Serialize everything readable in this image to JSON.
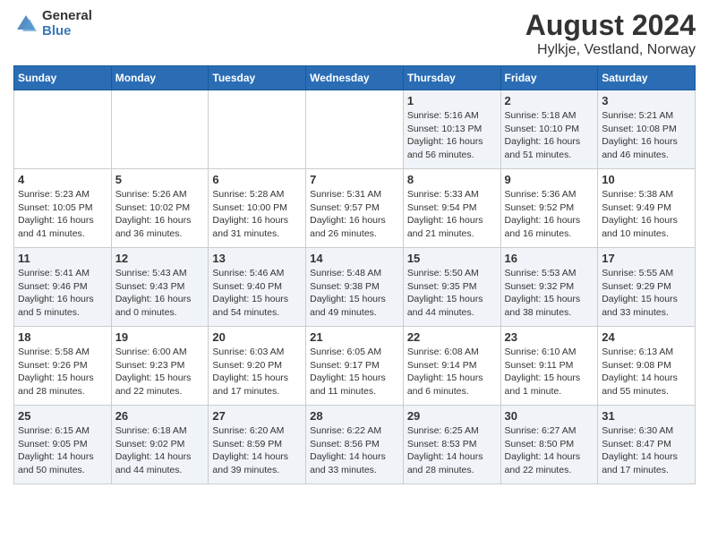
{
  "logo": {
    "line1": "General",
    "line2": "Blue"
  },
  "title": "August 2024",
  "subtitle": "Hylkje, Vestland, Norway",
  "headers": [
    "Sunday",
    "Monday",
    "Tuesday",
    "Wednesday",
    "Thursday",
    "Friday",
    "Saturday"
  ],
  "weeks": [
    [
      {
        "day": "",
        "info": ""
      },
      {
        "day": "",
        "info": ""
      },
      {
        "day": "",
        "info": ""
      },
      {
        "day": "",
        "info": ""
      },
      {
        "day": "1",
        "info": "Sunrise: 5:16 AM\nSunset: 10:13 PM\nDaylight: 16 hours\nand 56 minutes."
      },
      {
        "day": "2",
        "info": "Sunrise: 5:18 AM\nSunset: 10:10 PM\nDaylight: 16 hours\nand 51 minutes."
      },
      {
        "day": "3",
        "info": "Sunrise: 5:21 AM\nSunset: 10:08 PM\nDaylight: 16 hours\nand 46 minutes."
      }
    ],
    [
      {
        "day": "4",
        "info": "Sunrise: 5:23 AM\nSunset: 10:05 PM\nDaylight: 16 hours\nand 41 minutes."
      },
      {
        "day": "5",
        "info": "Sunrise: 5:26 AM\nSunset: 10:02 PM\nDaylight: 16 hours\nand 36 minutes."
      },
      {
        "day": "6",
        "info": "Sunrise: 5:28 AM\nSunset: 10:00 PM\nDaylight: 16 hours\nand 31 minutes."
      },
      {
        "day": "7",
        "info": "Sunrise: 5:31 AM\nSunset: 9:57 PM\nDaylight: 16 hours\nand 26 minutes."
      },
      {
        "day": "8",
        "info": "Sunrise: 5:33 AM\nSunset: 9:54 PM\nDaylight: 16 hours\nand 21 minutes."
      },
      {
        "day": "9",
        "info": "Sunrise: 5:36 AM\nSunset: 9:52 PM\nDaylight: 16 hours\nand 16 minutes."
      },
      {
        "day": "10",
        "info": "Sunrise: 5:38 AM\nSunset: 9:49 PM\nDaylight: 16 hours\nand 10 minutes."
      }
    ],
    [
      {
        "day": "11",
        "info": "Sunrise: 5:41 AM\nSunset: 9:46 PM\nDaylight: 16 hours\nand 5 minutes."
      },
      {
        "day": "12",
        "info": "Sunrise: 5:43 AM\nSunset: 9:43 PM\nDaylight: 16 hours\nand 0 minutes."
      },
      {
        "day": "13",
        "info": "Sunrise: 5:46 AM\nSunset: 9:40 PM\nDaylight: 15 hours\nand 54 minutes."
      },
      {
        "day": "14",
        "info": "Sunrise: 5:48 AM\nSunset: 9:38 PM\nDaylight: 15 hours\nand 49 minutes."
      },
      {
        "day": "15",
        "info": "Sunrise: 5:50 AM\nSunset: 9:35 PM\nDaylight: 15 hours\nand 44 minutes."
      },
      {
        "day": "16",
        "info": "Sunrise: 5:53 AM\nSunset: 9:32 PM\nDaylight: 15 hours\nand 38 minutes."
      },
      {
        "day": "17",
        "info": "Sunrise: 5:55 AM\nSunset: 9:29 PM\nDaylight: 15 hours\nand 33 minutes."
      }
    ],
    [
      {
        "day": "18",
        "info": "Sunrise: 5:58 AM\nSunset: 9:26 PM\nDaylight: 15 hours\nand 28 minutes."
      },
      {
        "day": "19",
        "info": "Sunrise: 6:00 AM\nSunset: 9:23 PM\nDaylight: 15 hours\nand 22 minutes."
      },
      {
        "day": "20",
        "info": "Sunrise: 6:03 AM\nSunset: 9:20 PM\nDaylight: 15 hours\nand 17 minutes."
      },
      {
        "day": "21",
        "info": "Sunrise: 6:05 AM\nSunset: 9:17 PM\nDaylight: 15 hours\nand 11 minutes."
      },
      {
        "day": "22",
        "info": "Sunrise: 6:08 AM\nSunset: 9:14 PM\nDaylight: 15 hours\nand 6 minutes."
      },
      {
        "day": "23",
        "info": "Sunrise: 6:10 AM\nSunset: 9:11 PM\nDaylight: 15 hours\nand 1 minute."
      },
      {
        "day": "24",
        "info": "Sunrise: 6:13 AM\nSunset: 9:08 PM\nDaylight: 14 hours\nand 55 minutes."
      }
    ],
    [
      {
        "day": "25",
        "info": "Sunrise: 6:15 AM\nSunset: 9:05 PM\nDaylight: 14 hours\nand 50 minutes."
      },
      {
        "day": "26",
        "info": "Sunrise: 6:18 AM\nSunset: 9:02 PM\nDaylight: 14 hours\nand 44 minutes."
      },
      {
        "day": "27",
        "info": "Sunrise: 6:20 AM\nSunset: 8:59 PM\nDaylight: 14 hours\nand 39 minutes."
      },
      {
        "day": "28",
        "info": "Sunrise: 6:22 AM\nSunset: 8:56 PM\nDaylight: 14 hours\nand 33 minutes."
      },
      {
        "day": "29",
        "info": "Sunrise: 6:25 AM\nSunset: 8:53 PM\nDaylight: 14 hours\nand 28 minutes."
      },
      {
        "day": "30",
        "info": "Sunrise: 6:27 AM\nSunset: 8:50 PM\nDaylight: 14 hours\nand 22 minutes."
      },
      {
        "day": "31",
        "info": "Sunrise: 6:30 AM\nSunset: 8:47 PM\nDaylight: 14 hours\nand 17 minutes."
      }
    ]
  ]
}
